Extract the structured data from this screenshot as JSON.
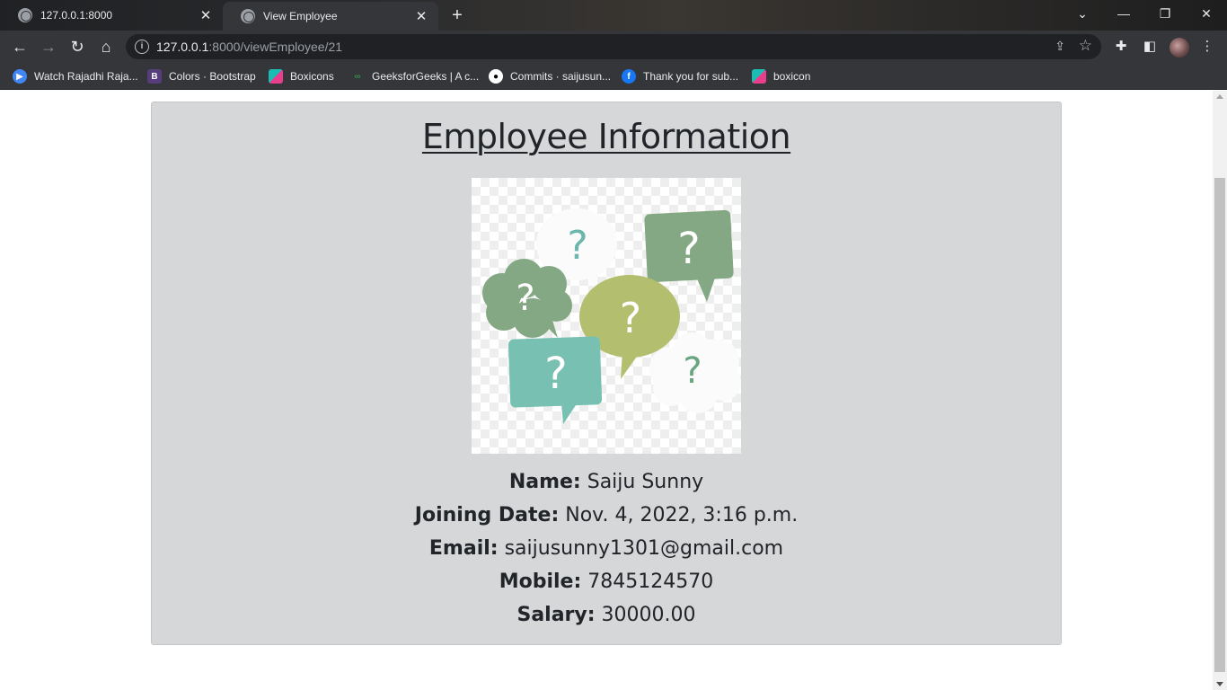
{
  "browser": {
    "tabs": [
      {
        "title": "127.0.0.1:8000",
        "active": false
      },
      {
        "title": "View Employee",
        "active": true
      }
    ],
    "address": {
      "host": "127.0.0.1",
      "path": ":8000/viewEmployee/21"
    },
    "bookmarks": [
      {
        "label": "Watch Rajadhi Raja...",
        "icon": "play-icon",
        "color": "#4285f4"
      },
      {
        "label": "Colors · Bootstrap",
        "icon": "bootstrap-icon",
        "color": "#7952b3"
      },
      {
        "label": "Boxicons",
        "icon": "boxicons-icon",
        "color": "#1abcb4"
      },
      {
        "label": "GeeksforGeeks | A c...",
        "icon": "geeksforgeeks-icon",
        "color": "#2f8d46"
      },
      {
        "label": "Commits · saijusun...",
        "icon": "github-icon",
        "color": "#ffffff"
      },
      {
        "label": "Thank you for sub...",
        "icon": "facebook-icon",
        "color": "#1877f2"
      },
      {
        "label": "boxicon",
        "icon": "boxicons-icon",
        "color": "#1abcb4"
      }
    ]
  },
  "page": {
    "heading": "Employee Information",
    "photo_alt": "question-bubbles-image",
    "fields": [
      {
        "label": "Name:",
        "value": "Saiju Sunny"
      },
      {
        "label": "Joining Date:",
        "value": "Nov. 4, 2022, 3:16 p.m."
      },
      {
        "label": "Email:",
        "value": "saijusunny1301@gmail.com"
      },
      {
        "label": "Mobile:",
        "value": "7845124570"
      },
      {
        "label": "Salary:",
        "value": "30000.00"
      }
    ]
  },
  "colors": {
    "card_bg": "#d6d7d9",
    "text": "#212529",
    "bubble_green": "#84a883",
    "bubble_olive": "#b3bf6e",
    "bubble_teal": "#77c0b2"
  }
}
